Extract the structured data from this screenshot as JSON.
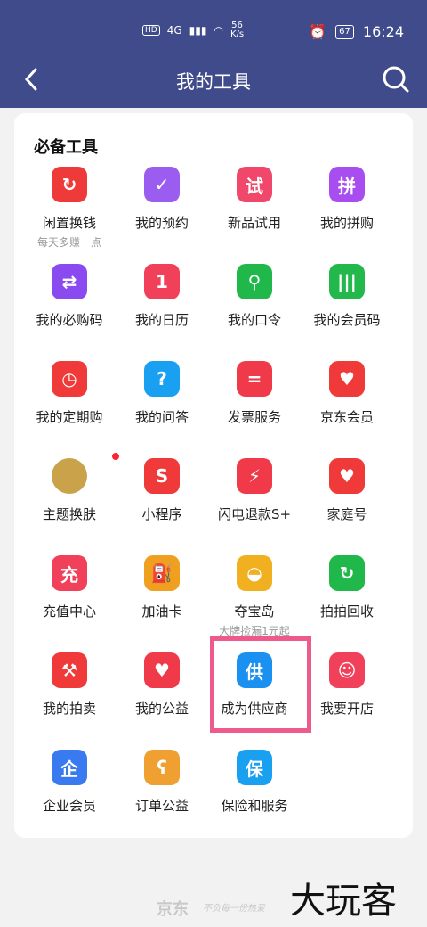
{
  "status_bar": {
    "hd": "HD",
    "network": "4G",
    "speed_value": "56",
    "speed_unit": "K/s",
    "battery": "67",
    "time": "16:24"
  },
  "nav": {
    "title": "我的工具"
  },
  "section": {
    "title": "必备工具"
  },
  "items": [
    {
      "label": "闲置换钱",
      "sub": "每天多赚一点",
      "icon": "recycle-icon",
      "glyph": "↻",
      "color": "#ef3a3a"
    },
    {
      "label": "我的预约",
      "icon": "calendar-check-icon",
      "glyph": "✓",
      "color": "#9b5cf0"
    },
    {
      "label": "新品试用",
      "icon": "trial-icon",
      "glyph": "试",
      "color": "#f0476a"
    },
    {
      "label": "我的拼购",
      "icon": "cart-icon",
      "glyph": "拼",
      "color": "#a84ef0"
    },
    {
      "label": "我的必购码",
      "icon": "ticket-icon",
      "glyph": "⇄",
      "color": "#8a4af0"
    },
    {
      "label": "我的日历",
      "icon": "calendar-icon",
      "glyph": "1",
      "color": "#f0405a"
    },
    {
      "label": "我的口令",
      "icon": "key-icon",
      "glyph": "⚲",
      "color": "#20b84a"
    },
    {
      "label": "我的会员码",
      "icon": "barcode-icon",
      "glyph": "|||",
      "color": "#22b84c"
    },
    {
      "label": "我的定期购",
      "icon": "alarm-icon",
      "glyph": "◷",
      "color": "#f03a3a"
    },
    {
      "label": "我的问答",
      "icon": "question-icon",
      "glyph": "?",
      "color": "#1aa0f0"
    },
    {
      "label": "发票服务",
      "icon": "invoice-icon",
      "glyph": "=",
      "color": "#f03a4a"
    },
    {
      "label": "京东会员",
      "icon": "member-icon",
      "glyph": "♥",
      "color": "#f03a3a"
    },
    {
      "label": "主题换肤",
      "icon": "theme-icon",
      "glyph": "",
      "color": "#c9a24a"
    },
    {
      "label": "小程序",
      "icon": "miniprogram-icon",
      "glyph": "S",
      "color": "#f03a3a"
    },
    {
      "label": "闪电退款S+",
      "icon": "lightning-icon",
      "glyph": "⚡",
      "color": "#f03a4a"
    },
    {
      "label": "家庭号",
      "icon": "home-icon",
      "glyph": "♥",
      "color": "#f03a3a"
    },
    {
      "label": "充值中心",
      "icon": "recharge-icon",
      "glyph": "充",
      "color": "#f0405a"
    },
    {
      "label": "加油卡",
      "icon": "fuel-icon",
      "glyph": "⛽",
      "color": "#f0a020"
    },
    {
      "label": "夺宝岛",
      "sub": "大牌捡漏1元起",
      "icon": "gold-ingot-icon",
      "glyph": "◒",
      "color": "#f0b020"
    },
    {
      "label": "拍拍回收",
      "icon": "recycle-phone-icon",
      "glyph": "↻",
      "color": "#20b84a"
    },
    {
      "label": "我的拍卖",
      "icon": "gavel-icon",
      "glyph": "⚒",
      "color": "#f03a3a"
    },
    {
      "label": "我的公益",
      "icon": "heart-hand-icon",
      "glyph": "♥",
      "color": "#f03a4a"
    },
    {
      "label": "成为供应商",
      "icon": "supplier-icon",
      "glyph": "供",
      "color": "#1a90f0"
    },
    {
      "label": "我要开店",
      "icon": "shop-icon",
      "glyph": "☺",
      "color": "#f0405a"
    },
    {
      "label": "企业会员",
      "icon": "enterprise-icon",
      "glyph": "企",
      "color": "#3a7af0"
    },
    {
      "label": "订单公益",
      "icon": "bear-icon",
      "glyph": "ʕ",
      "color": "#f0a030"
    },
    {
      "label": "保险和服务",
      "icon": "insurance-icon",
      "glyph": "保",
      "color": "#1aa0f0"
    }
  ],
  "footer": {
    "brand": "京东",
    "slogan": "不负每一份热爱",
    "watermark": "大玩客"
  }
}
